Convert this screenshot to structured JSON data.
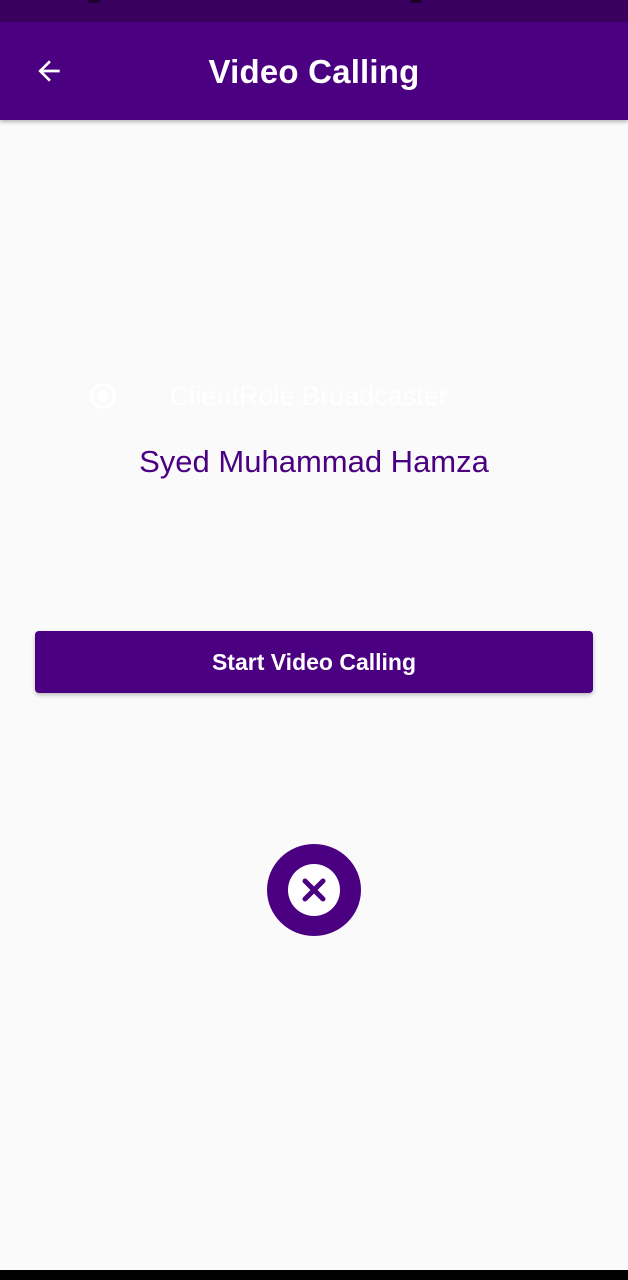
{
  "app_bar": {
    "title": "Video Calling",
    "back_icon": "arrow-left-icon"
  },
  "client_role": {
    "selected": true,
    "label": "ClientRole.Broadcaster"
  },
  "user": {
    "name": "Syed Muhammad Hamza"
  },
  "actions": {
    "start_label": "Start Video Calling",
    "end_icon": "close-circle-icon"
  },
  "colors": {
    "primary": "#4b0082",
    "status_bar": "#3a0060",
    "background": "#fafafa",
    "on_primary": "#ffffff"
  }
}
